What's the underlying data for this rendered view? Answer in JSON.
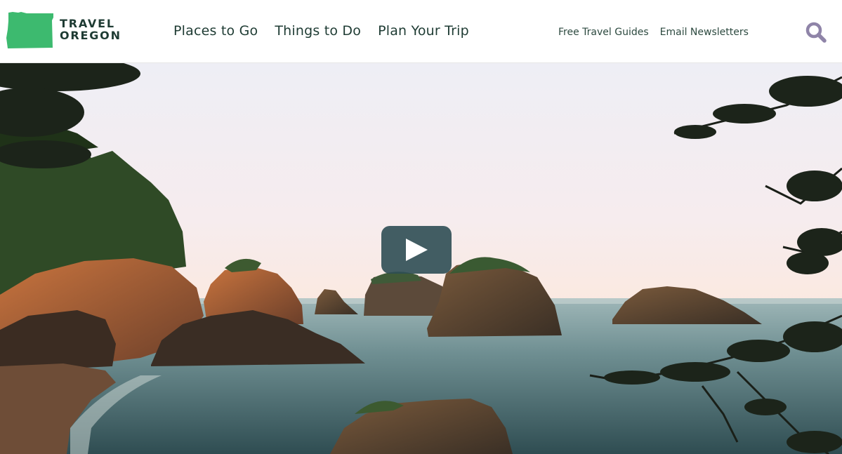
{
  "brand": {
    "logo_line1": "TRAVEL",
    "logo_line2": "OREGON",
    "logo_color": "#3dba6f",
    "text_color": "#1e3b33"
  },
  "main_nav": {
    "items": [
      {
        "label": "Places to Go"
      },
      {
        "label": "Things to Do"
      },
      {
        "label": "Plan Your Trip"
      }
    ]
  },
  "utility_nav": {
    "items": [
      {
        "label": "Free Travel Guides"
      },
      {
        "label": "Email Newsletters"
      }
    ]
  },
  "search": {
    "icon": "search-icon",
    "icon_color": "#8f84a8"
  },
  "hero": {
    "type": "video",
    "play_icon": "play-icon",
    "play_button_color": "#2d4e54"
  }
}
